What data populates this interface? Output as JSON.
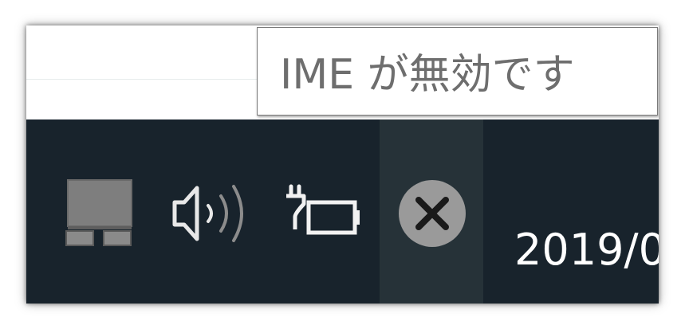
{
  "tooltip": {
    "text": "IME が無効です"
  },
  "tray": {
    "icons": [
      "network-icon",
      "volume-icon",
      "battery-charging-icon",
      "ime-disabled-icon"
    ]
  },
  "clock": {
    "date_partial": "2019/0"
  },
  "colors": {
    "taskbar": "#18232c",
    "tray_hover": "#263238",
    "tooltip_bg": "#ffffff",
    "tooltip_text": "#6e6e6e"
  }
}
